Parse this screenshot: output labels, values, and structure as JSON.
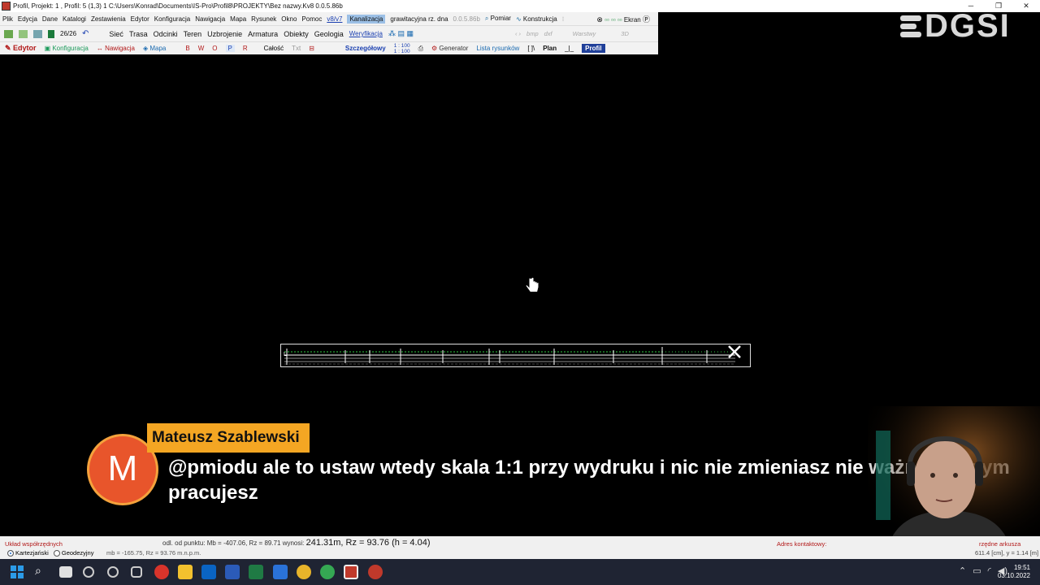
{
  "window": {
    "title": "Profil,   Projekt: 1  , Profil: 5  (1,3) 1     C:\\Users\\Konrad\\Documents\\IS-Pro\\Profil8\\PROJEKTY\\Bez nazwy.Kv8 0.0.5.86b",
    "minimize": "─",
    "restore": "❐",
    "close": "✕"
  },
  "menu": {
    "items": [
      "Plik",
      "Edycja",
      "Dane",
      "Katalogi",
      "Zestawienia",
      "Edytor",
      "Konfiguracja",
      "Nawigacja",
      "Mapa",
      "Rysunek",
      "Okno",
      "Pomoc"
    ],
    "version_link": "v8/v7",
    "mode": "Kanalizacja",
    "mode_extra": "grawitacyjna  rz. dna",
    "build": "0.0.5.86b",
    "pomiar": "Pomiar",
    "konstrukcja": "Konstrukcja",
    "ekran": "Ekran"
  },
  "toolbar": {
    "counter": "26/26",
    "items": [
      "Sieć",
      "Trasa",
      "Odcinki",
      "Teren",
      "Uzbrojenie",
      "Armatura",
      "Obiekty",
      "Geologia"
    ],
    "weryfikacja": "Weryfikacja",
    "bmp": "bmp",
    "dxf": "dxf",
    "warstwy": "Warstwy",
    "view3d": "3D"
  },
  "panel": {
    "edytor": "Edytor",
    "konfiguracja": "Konfiguracja",
    "nawigacja": "Nawigacja",
    "mapa": "Mapa",
    "views": [
      "B",
      "W",
      "O",
      "P",
      "R"
    ],
    "calosc": "Całość",
    "txt": "Txt",
    "szczegolowy": "Szczegółowy",
    "scale_top": "1 : 100",
    "scale_bottom": "1 : 100",
    "generator": "Generator",
    "lista": "Lista rysunków",
    "brackets": "[ ]\\",
    "plan": "Plan",
    "sep": "_|_",
    "profil": "Profil"
  },
  "logo": {
    "text": "DGSI"
  },
  "chat": {
    "avatar_letter": "M",
    "author": "Mateusz Szablewski",
    "message": "@pmiodu ale to ustaw wtedy skala 1:1 przy wydruku i nic nie zmieniasz nie ważne na czym pracujesz"
  },
  "status": {
    "uklad": "Układ współrzędnych",
    "kartezjanski": "Kartezjański",
    "geodezyjny": "Geodezyjny",
    "odl_label": "odl. od punktu:",
    "mb": "Mb = -407.06,",
    "rz": "Rz = 89.71",
    "wynosi": "wynosi:",
    "main_value": "241.31m,  Rz = 93.76  (h = 4.04)",
    "mb_line": "mb = -165.75, Rz = 93.76 m.n.p.m.",
    "adres": "Adres kontaktowy:",
    "arkusz": "rzędne arkusza",
    "arkusz_values": "611.4 [cm],   y = 1.14 [m]"
  },
  "clock": {
    "time": "19:51",
    "date": "03.10.2022"
  },
  "colors": {
    "accent_orange": "#f4a623",
    "avatar": "#e8552b",
    "profil_active": "#1f3f99"
  }
}
